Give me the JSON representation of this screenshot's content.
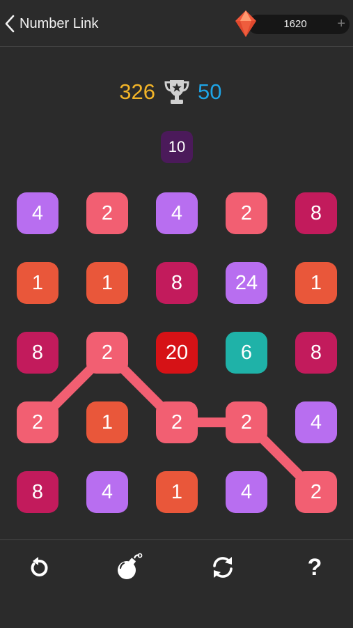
{
  "header": {
    "title": "Number Link",
    "gems": "1620",
    "plus": "+"
  },
  "scores": {
    "current": "326",
    "best": "50"
  },
  "target": "10",
  "grid": [
    [
      "4",
      "2",
      "4",
      "2",
      "8"
    ],
    [
      "1",
      "1",
      "8",
      "24",
      "1"
    ],
    [
      "8",
      "2",
      "20",
      "6",
      "8"
    ],
    [
      "2",
      "1",
      "2",
      "2",
      "4"
    ],
    [
      "8",
      "4",
      "1",
      "4",
      "2"
    ]
  ],
  "tile_colors": {
    "1": "#e9573a",
    "2": "#f25f72",
    "4": "#b86ef0",
    "6": "#1fb2a8",
    "8": "#c21b5c",
    "20": "#d61216",
    "24": "#b86ef0"
  },
  "link_color": "#f25f72",
  "linked_path": [
    [
      3,
      0
    ],
    [
      2,
      1
    ],
    [
      3,
      2
    ],
    [
      3,
      3
    ],
    [
      4,
      4
    ]
  ],
  "footer": {
    "tools": [
      "undo-icon",
      "bomb-icon",
      "refresh-icon",
      "help-icon"
    ],
    "help_label": "?"
  }
}
